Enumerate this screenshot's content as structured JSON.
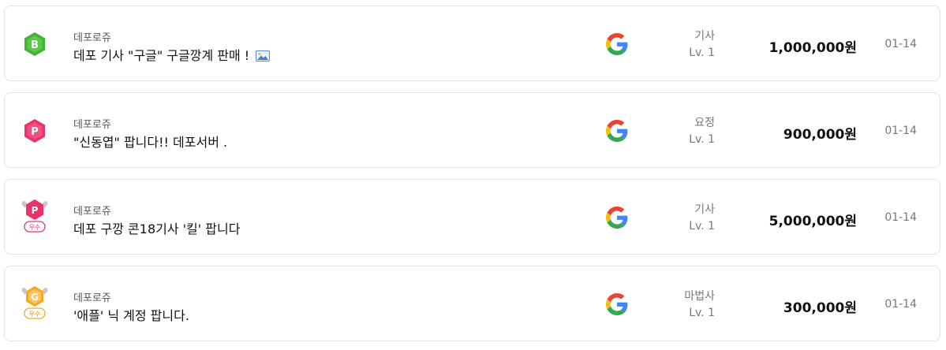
{
  "listings": [
    {
      "badge": "B",
      "badge_tag": "",
      "server": "데포로쥬",
      "title": "데포 기사 \"구글\" 구글깡계 판매 !",
      "has_image": true,
      "job": "기사",
      "level": "Lv. 1",
      "price": "1,000,000원",
      "date": "01-14"
    },
    {
      "badge": "P",
      "badge_tag": "",
      "server": "데포로쥬",
      "title": "\"신동엽\" 팝니다!! 데포서버 .",
      "has_image": false,
      "job": "요정",
      "level": "Lv. 1",
      "price": "900,000원",
      "date": "01-14"
    },
    {
      "badge": "P",
      "badge_tag": "우수",
      "server": "데포로쥬",
      "title": "데포 구깡 콘18기사 '킬' 팝니다",
      "has_image": false,
      "job": "기사",
      "level": "Lv. 1",
      "price": "5,000,000원",
      "date": "01-14"
    },
    {
      "badge": "G",
      "badge_tag": "우수",
      "server": "데포로쥬",
      "title": "'애플' 닉 계정 팝니다.",
      "has_image": false,
      "job": "마법사",
      "level": "Lv. 1",
      "price": "300,000원",
      "date": "01-14"
    }
  ],
  "icons": {
    "badge_b": "grade-b-badge-icon",
    "badge_p": "grade-p-badge-icon",
    "badge_p_excellent": "grade-p-excellent-badge-icon",
    "badge_g_excellent": "grade-g-excellent-badge-icon",
    "google": "google-icon",
    "image": "image-attachment-icon"
  },
  "colors": {
    "green": "#43b233",
    "pink": "#e8336b",
    "orange": "#f5a623",
    "border": "#e3e3e6"
  }
}
